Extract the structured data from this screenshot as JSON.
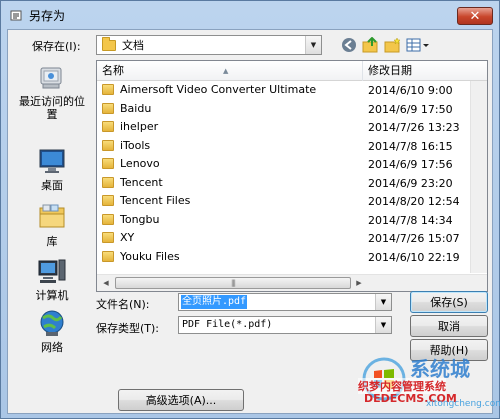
{
  "window": {
    "title": "另存为",
    "close_label": "✕"
  },
  "save_in": {
    "label": "保存在(I):",
    "value": "文档"
  },
  "places": [
    {
      "label": "最近访问的位置",
      "icon": "recent-places-icon"
    },
    {
      "label": "桌面",
      "icon": "desktop-icon"
    },
    {
      "label": "库",
      "icon": "libraries-icon"
    },
    {
      "label": "计算机",
      "icon": "computer-icon"
    },
    {
      "label": "网络",
      "icon": "network-icon"
    }
  ],
  "file_list": {
    "headers": {
      "name": "名称",
      "date": "修改日期"
    },
    "rows": [
      {
        "name": "Aimersoft Video Converter Ultimate",
        "date": "2014/6/10 9:00"
      },
      {
        "name": "Baidu",
        "date": "2014/6/9 17:50"
      },
      {
        "name": "ihelper",
        "date": "2014/7/26 13:23"
      },
      {
        "name": "iTools",
        "date": "2014/7/8 16:15"
      },
      {
        "name": "Lenovo",
        "date": "2014/6/9 17:56"
      },
      {
        "name": "Tencent",
        "date": "2014/6/9 23:20"
      },
      {
        "name": "Tencent Files",
        "date": "2014/8/20 12:54"
      },
      {
        "name": "Tongbu",
        "date": "2014/7/8 14:34"
      },
      {
        "name": "XY",
        "date": "2014/7/26 15:07"
      },
      {
        "name": "Youku Files",
        "date": "2014/6/10 22:19"
      }
    ]
  },
  "filename": {
    "label": "文件名(N):",
    "value": "全页照片.pdf"
  },
  "filetype": {
    "label": "保存类型(T):",
    "value": "PDF File(*.pdf)"
  },
  "buttons": {
    "save": "保存(S)",
    "cancel": "取消",
    "help": "帮助(H)",
    "advanced": "高级选项(A)..."
  },
  "watermark": {
    "brand": "系统城",
    "sub": "织梦内容管理系统",
    "site": "DEDECMS.COM",
    "url": "xitongcheng.com"
  },
  "colors": {
    "titlebar": "#bcd4ee",
    "close": "#c8452b",
    "selection": "#3399ff",
    "folder": "#f3c64a"
  }
}
